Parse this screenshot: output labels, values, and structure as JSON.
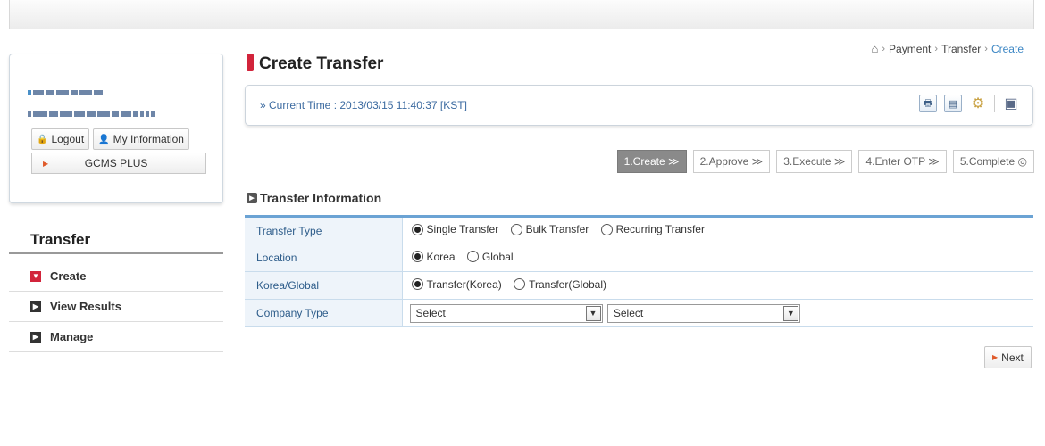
{
  "user": {
    "logout_label": "Logout",
    "my_info_label": "My Information",
    "gcms_label": "GCMS PLUS"
  },
  "nav": {
    "title": "Transfer",
    "items": [
      {
        "label": "Create"
      },
      {
        "label": "View Results"
      },
      {
        "label": "Manage"
      }
    ]
  },
  "header": {
    "title": "Create Transfer",
    "breadcrumb": [
      "Payment",
      "Transfer",
      "Create"
    ],
    "current_time": "» Current Time : 2013/03/15 11:40:37 [KST]"
  },
  "toolbar_icons": [
    "printer-icon",
    "document-icon",
    "user-settings-icon",
    "window-settings-icon"
  ],
  "steps": [
    "1.Create ≫",
    "2.Approve ≫",
    "3.Execute ≫",
    "4.Enter OTP ≫",
    "5.Complete ◎"
  ],
  "section": {
    "title": "Transfer Information"
  },
  "form": {
    "transfer_type": {
      "label": "Transfer Type",
      "options": [
        "Single Transfer",
        "Bulk Transfer",
        "Recurring Transfer"
      ],
      "selected": "Single Transfer"
    },
    "location": {
      "label": "Location",
      "options": [
        "Korea",
        "Global"
      ],
      "selected": "Korea"
    },
    "korea_global": {
      "label": "Korea/Global",
      "options": [
        "Transfer(Korea)",
        "Transfer(Global)"
      ],
      "selected": "Transfer(Korea)"
    },
    "company_type": {
      "label": "Company Type",
      "select1": "Select",
      "select2": "Select"
    }
  },
  "next_label": "Next",
  "colors": {
    "accent_red": "#d2243b",
    "table_border": "#6ba3d4",
    "link_blue": "#3b86c4"
  }
}
